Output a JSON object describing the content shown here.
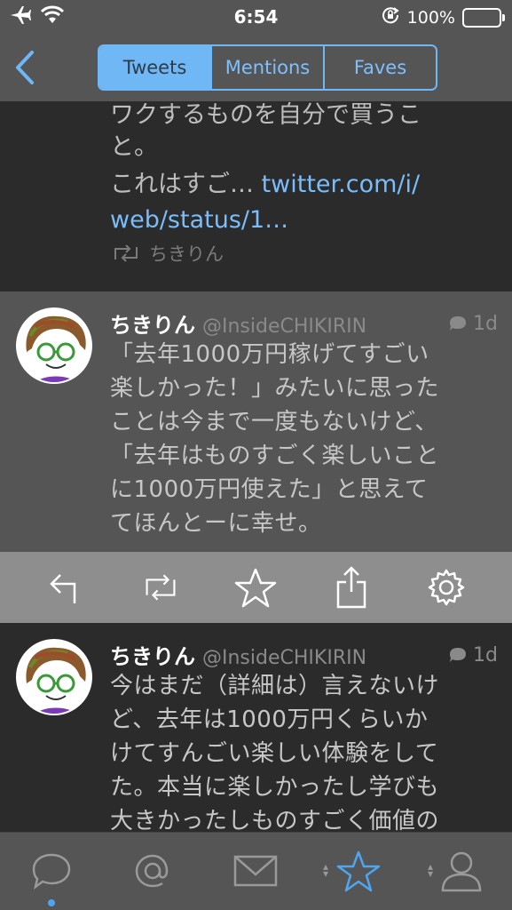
{
  "status_bar": {
    "time": "6:54",
    "battery": "100%",
    "icons": [
      "airplane-icon",
      "wifi-icon",
      "orientation-lock-icon",
      "battery-icon"
    ]
  },
  "nav": {
    "tabs": [
      {
        "label": "Tweets",
        "active": true
      },
      {
        "label": "Mentions",
        "active": false
      },
      {
        "label": "Faves",
        "active": false
      }
    ]
  },
  "partial_tweet": {
    "lines": [
      "ワクするものを自分で買うこ",
      "と。"
    ],
    "truncated_prefix": "これはすご… ",
    "link_part1": "twitter.com/i/",
    "link_part2": "web/status/1…",
    "retweeted_by": "ちきりん"
  },
  "selected_tweet": {
    "name": "ちきりん",
    "handle": "@InsideCHIKIRIN",
    "age": "1d",
    "lines": [
      "「去年1000万円稼げてすごい",
      "楽しかった！」みたいに思った",
      "ことは今まで一度もないけど、",
      "「去年はものすごく楽しいこと",
      "に1000万円使えた」と思えて",
      "てほんとーに幸せ。"
    ]
  },
  "actions": [
    "reply-icon",
    "retweet-icon",
    "star-icon",
    "share-icon",
    "gear-icon"
  ],
  "next_tweet": {
    "name": "ちきりん",
    "handle": "@InsideCHIKIRIN",
    "age": "1d",
    "lines": [
      "今はまだ（詳細は）言えないけ",
      "ど、去年は1000万円くらいか",
      "けてすんごい楽しい体験をして",
      "た。本当に楽しかったし学びも",
      "大きかったしものすごく価値の"
    ]
  },
  "tab_bar": {
    "items": [
      "timeline-icon",
      "mentions-icon",
      "messages-icon",
      "favorites-icon",
      "profile-icon"
    ],
    "accent_color": "#4fa6f0"
  },
  "colors": {
    "accent": "#6fb7f5",
    "link": "#79bdfa",
    "selected_bg": "#555555",
    "dark_bg": "#2b2b2b"
  }
}
